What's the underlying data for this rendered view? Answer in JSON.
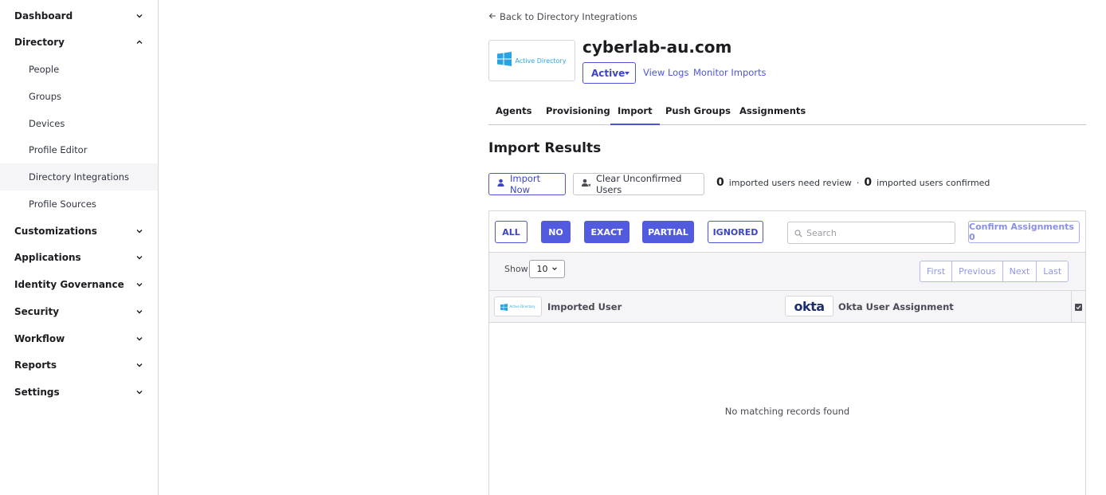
{
  "sidebar": {
    "items": [
      {
        "label": "Dashboard",
        "expanded": false
      },
      {
        "label": "Directory",
        "expanded": true
      },
      {
        "label": "Customizations",
        "expanded": false
      },
      {
        "label": "Applications",
        "expanded": false
      },
      {
        "label": "Identity Governance",
        "expanded": false
      },
      {
        "label": "Security",
        "expanded": false
      },
      {
        "label": "Workflow",
        "expanded": false
      },
      {
        "label": "Reports",
        "expanded": false
      },
      {
        "label": "Settings",
        "expanded": false
      }
    ],
    "directory_sub": [
      "People",
      "Groups",
      "Devices",
      "Profile Editor",
      "Directory Integrations",
      "Profile Sources"
    ],
    "active_sub": "Directory Integrations"
  },
  "header": {
    "back_link": "Back to Directory Integrations",
    "logo_text": "Active Directory",
    "title": "cyberlab-au.com",
    "status": "Active",
    "view_logs": "View Logs",
    "monitor_imports": "Monitor Imports"
  },
  "tabs": [
    "Agents",
    "Provisioning",
    "Import",
    "Push Groups",
    "Assignments"
  ],
  "active_tab": "Import",
  "import": {
    "title": "Import Results",
    "import_now": "Import Now",
    "clear_unconfirmed": "Clear Unconfirmed Users",
    "review_count": "0",
    "review_label": "imported users need review",
    "separator": "·",
    "confirmed_count": "0",
    "confirmed_label": "imported users confirmed"
  },
  "filters": {
    "all": "ALL",
    "no": "NO",
    "exact": "EXACT",
    "partial": "PARTIAL",
    "ignored": "IGNORED",
    "search_placeholder": "Search",
    "confirm_assignments": "Confirm Assignments 0"
  },
  "paging": {
    "show_label": "Show",
    "page_size": "10",
    "first": "First",
    "previous": "Previous",
    "next": "Next",
    "last": "Last"
  },
  "table": {
    "col_imported": "Imported User",
    "okta_logo": "okta",
    "col_assignment": "Okta User Assignment",
    "empty_message": "No matching records found"
  },
  "colors": {
    "accent": "#4d56d8",
    "solid_button": "#525ae0",
    "windows_blue": "#2aa3e5"
  }
}
